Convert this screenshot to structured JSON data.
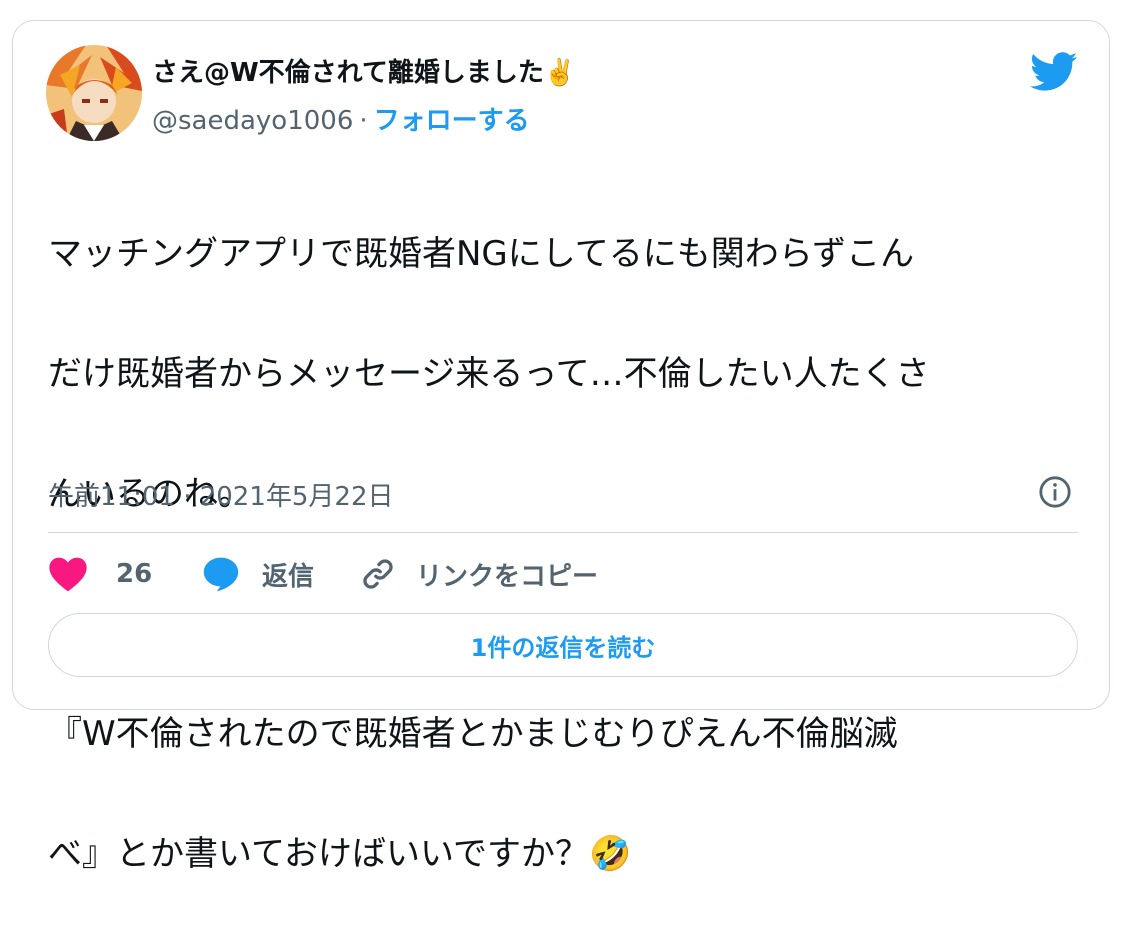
{
  "author": {
    "display_name": "さえ@W不倫されて離婚しました",
    "name_emoji": "✌️",
    "handle": "@saedayo1006",
    "separator": "·",
    "follow_label": "フォローする",
    "avatar_icon": "anime-character-avatar"
  },
  "tweet": {
    "line1": "マッチングアプリで既婚者NGにしてるにも関わらずこん",
    "line2": "だけ既婚者からメッセージ来るって…不倫したい人たくさ",
    "line3": "んいるのね。",
    "line4": "『W不倫されたので既婚者とかまじむりぴえん不倫脳滅",
    "line5": "べ』とか書いておけばいいですか？",
    "emoji": "🤣",
    "timestamp": "午前11:01 · 2021年5月22日"
  },
  "actions": {
    "like_count": "26",
    "reply_label": "返信",
    "copy_link_label": "リンクをコピー"
  },
  "read_replies_label": "1件の返信を読む",
  "colors": {
    "brand_blue": "#1d9bf0",
    "like_pink": "#f91880",
    "secondary_text": "#536471",
    "border": "#cfd9de"
  }
}
